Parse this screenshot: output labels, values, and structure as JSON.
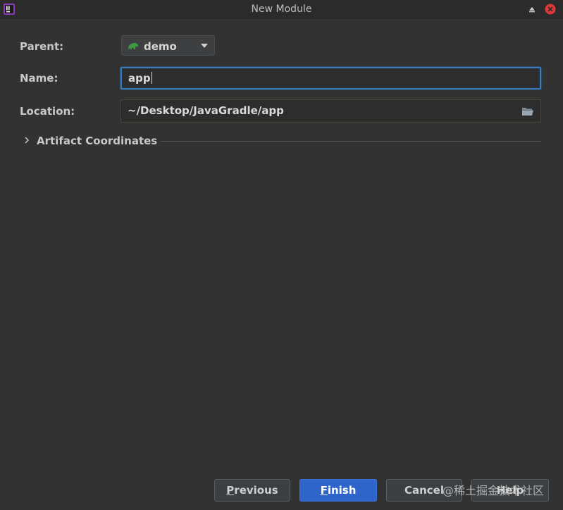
{
  "window": {
    "title": "New Module",
    "icons": {
      "app": "intellij-app-icon",
      "maximize": "triangle-up-icon",
      "close": "close-icon"
    }
  },
  "form": {
    "parent": {
      "label": "Parent:",
      "value": "demo",
      "icon": "gradle-elephant-icon"
    },
    "name": {
      "label": "Name:",
      "value": "app"
    },
    "location": {
      "label": "Location:",
      "value": "~/Desktop/JavaGradle/app",
      "icon": "folder-icon"
    },
    "artifact": {
      "label": "Artifact Coordinates",
      "expanded": false
    }
  },
  "buttons": {
    "previous": {
      "mnemonic": "P",
      "rest": "revious"
    },
    "finish": {
      "mnemonic": "F",
      "rest": "inish"
    },
    "cancel": "Cancel",
    "help": "Help"
  },
  "watermark": "@稀土掘金技术社区",
  "colors": {
    "background": "#323232",
    "accent": "#3f7bb5",
    "primary_button": "#2f65ca",
    "gradle_green": "#3f9b3f",
    "close_red": "#e0393c"
  }
}
